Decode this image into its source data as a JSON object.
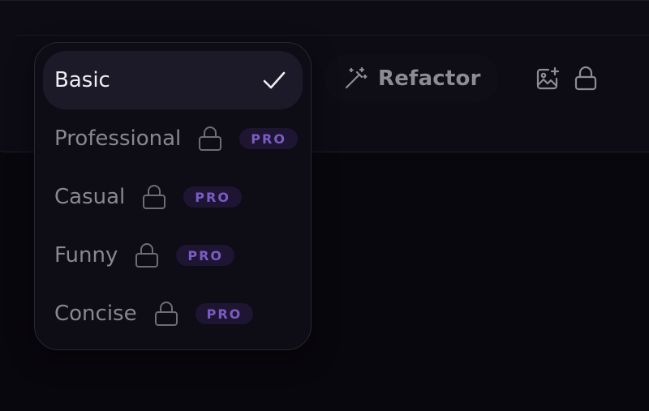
{
  "toolbar": {
    "refactor_label": "Refactor",
    "refactor_icon": "magic-wand-icon",
    "image_icon": "image-plus-icon",
    "lock_icon": "lock-icon"
  },
  "tone_menu": {
    "selected": "Basic",
    "options": [
      {
        "label": "Basic",
        "locked": false,
        "badge": ""
      },
      {
        "label": "Professional",
        "locked": true,
        "badge": "PRO"
      },
      {
        "label": "Casual",
        "locked": true,
        "badge": "PRO"
      },
      {
        "label": "Funny",
        "locked": true,
        "badge": "PRO"
      },
      {
        "label": "Concise",
        "locked": true,
        "badge": "PRO"
      }
    ]
  },
  "colors": {
    "background": "#09070e",
    "panel": "#0d0b14",
    "selected_row": "#1c1a28",
    "text_muted": "#8a8794",
    "text_active": "#eeeef2",
    "pro_badge_bg": "#1e1533",
    "pro_badge_text": "#7b5cc4"
  }
}
